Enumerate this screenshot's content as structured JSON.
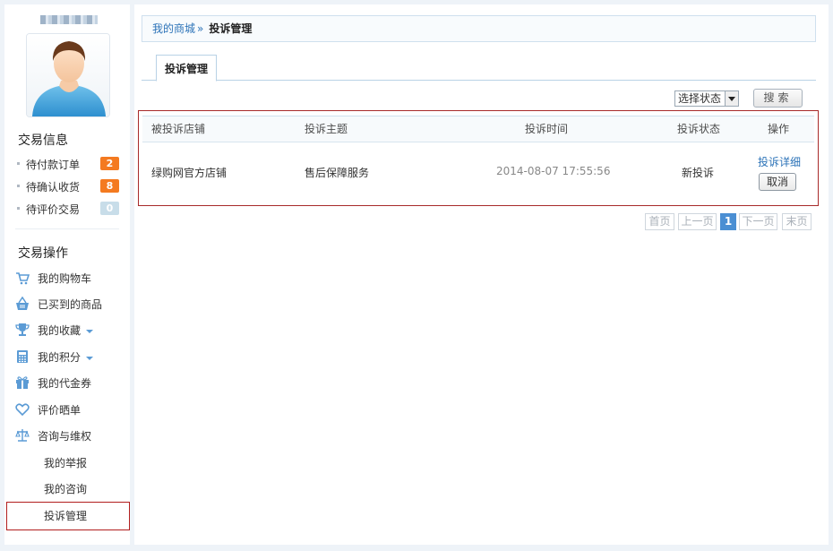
{
  "sidebar": {
    "trade_info_title": "交易信息",
    "trade_items": [
      {
        "label": "待付款订单",
        "count": "2"
      },
      {
        "label": "待确认收货",
        "count": "8"
      },
      {
        "label": "待评价交易",
        "count": "0"
      }
    ],
    "trade_ops_title": "交易操作",
    "ops": [
      {
        "label": "我的购物车",
        "icon": "cart-icon"
      },
      {
        "label": "已买到的商品",
        "icon": "basket-icon"
      },
      {
        "label": "我的收藏",
        "icon": "trophy-icon"
      },
      {
        "label": "我的积分",
        "icon": "calculator-icon"
      },
      {
        "label": "我的代金券",
        "icon": "gift-icon"
      },
      {
        "label": "评价晒单",
        "icon": "heart-icon"
      },
      {
        "label": "咨询与维权",
        "icon": "scale-icon"
      }
    ],
    "sub_items": [
      "我的举报",
      "我的咨询",
      "投诉管理"
    ]
  },
  "breadcrumb": {
    "home": "我的商城",
    "separator": "»",
    "current": "投诉管理"
  },
  "tab": {
    "label": "投诉管理"
  },
  "filter": {
    "status_selected": "选择状态",
    "search_label": "搜索"
  },
  "table": {
    "headers": [
      "被投诉店铺",
      "投诉主题",
      "投诉时间",
      "投诉状态",
      "操作"
    ],
    "rows": [
      {
        "store": "绿购网官方店铺",
        "subject": "售后保障服务",
        "time": "2014-08-07 17:55:56",
        "status": "新投诉",
        "detail": "投诉详细",
        "cancel": "取消"
      }
    ]
  },
  "pagination": {
    "first": "首页",
    "prev": "上一页",
    "current": "1",
    "next": "下一页",
    "last": "末页"
  },
  "colors": {
    "accent": "#2c73b8",
    "badge_orange": "#f47a20",
    "highlight_border": "#a82a2a",
    "icon_blue": "#5b9bd5"
  }
}
